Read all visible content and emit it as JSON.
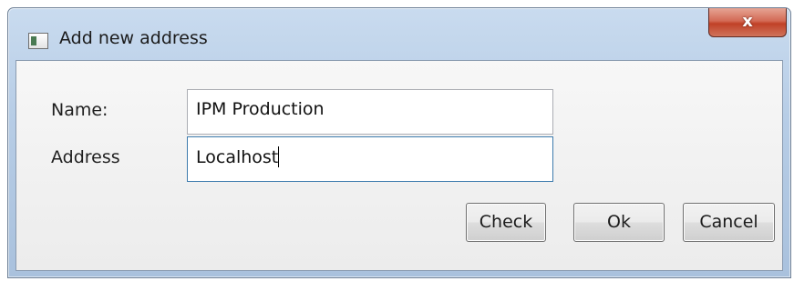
{
  "window": {
    "title": "Add new address",
    "close_label": "x",
    "colors": {
      "titlebar": "#b7cde6",
      "close_button": "#c04127",
      "client_background": "#f0f0f0",
      "focus_border": "#3d7bad"
    }
  },
  "form": {
    "name_label": "Name:",
    "name_value": "IPM Production",
    "address_label": "Address",
    "address_value": "Localhost"
  },
  "buttons": {
    "check": "Check",
    "ok": "Ok",
    "cancel": "Cancel"
  }
}
